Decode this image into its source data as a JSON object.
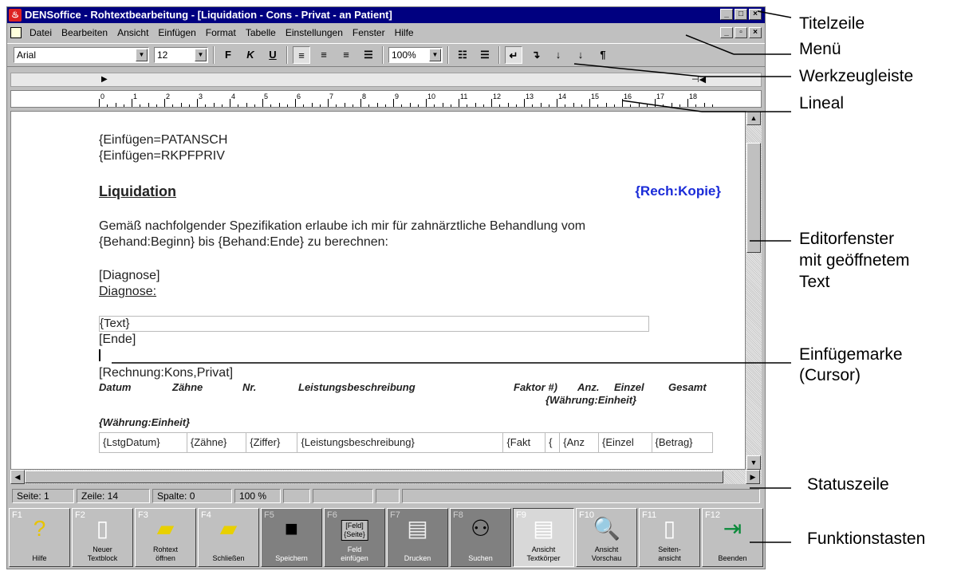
{
  "title": "DENSoffice - Rohtextbearbeitung - [Liquidation - Cons - Privat - an Patient]",
  "menu": [
    "Datei",
    "Bearbeiten",
    "Ansicht",
    "Einfügen",
    "Format",
    "Tabelle",
    "Einstellungen",
    "Fenster",
    "Hilfe"
  ],
  "toolbar": {
    "font": "Arial",
    "size": "12",
    "zoom": "100%",
    "bold": "F",
    "italic": "K",
    "underline": "U",
    "para": "¶"
  },
  "ruler": [
    "0",
    "1",
    "2",
    "3",
    "4",
    "5",
    "6",
    "7",
    "8",
    "9",
    "10",
    "11",
    "12",
    "13",
    "14",
    "15",
    "16",
    "17",
    "18"
  ],
  "doc": {
    "line1": "{Einfügen=PATANSCH",
    "line2": "{Einfügen=RKPFPRIV",
    "heading": "Liquidation",
    "copy": "{Rech:Kopie}",
    "para1": "Gemäß nachfolgender Spezifikation erlaube ich mir für zahnärztliche Behandlung vom",
    "para2": "{Behand:Beginn} bis {Behand:Ende} zu berechnen:",
    "diag1": "[Diagnose]",
    "diag2": "Diagnose:",
    "text": "{Text}",
    "end": "[Ende]",
    "rechnung": "[Rechnung:Kons,Privat]",
    "headers": [
      "Datum",
      "Zähne",
      "Nr.",
      "Leistungsbeschreibung",
      "Faktor #)",
      "Anz.",
      "Einzel",
      "Gesamt"
    ],
    "waehrung": "{Währung:Einheit}",
    "waehrung2": "{Währung:Einheit}",
    "cells": [
      "{LstgDatum}",
      "{Zähne}",
      "{Ziffer}",
      "{Leistungsbeschreibung}",
      "{Fakt",
      "{",
      "{Anz",
      "{Einzel",
      "{Betrag}"
    ]
  },
  "status": [
    "Seite:   1",
    "Zeile:  14",
    "Spalte:   0",
    "100 %",
    "",
    "",
    "",
    ""
  ],
  "fkeys": [
    {
      "fn": "F1",
      "label": "Hilfe",
      "icon": "question-icon"
    },
    {
      "fn": "F2",
      "label": "Neuer\nTextblock",
      "icon": "new-document-icon"
    },
    {
      "fn": "F3",
      "label": "Rohtext\nöffnen",
      "icon": "open-folder-icon"
    },
    {
      "fn": "F4",
      "label": "Schließen",
      "icon": "close-folder-icon"
    },
    {
      "fn": "F5",
      "label": "Speichern",
      "icon": "save-disk-icon"
    },
    {
      "fn": "F6",
      "label": "Feld\neinfügen",
      "icon": "insert-field-icon",
      "iconText": "[Feld]\n{Seite}"
    },
    {
      "fn": "F7",
      "label": "Drucken",
      "icon": "printer-icon"
    },
    {
      "fn": "F8",
      "label": "Suchen",
      "icon": "binoculars-icon"
    },
    {
      "fn": "F9",
      "label": "Ansicht\nTextkörper",
      "icon": "text-view-icon"
    },
    {
      "fn": "F10",
      "label": "Ansicht\nVorschau",
      "icon": "preview-icon"
    },
    {
      "fn": "F11",
      "label": "Seiten-\nansicht",
      "icon": "page-view-icon"
    },
    {
      "fn": "F12",
      "label": "Beenden",
      "icon": "exit-door-icon"
    }
  ],
  "callouts": {
    "titel": "Titelzeile",
    "menu": "Menü",
    "werkzeug": "Werkzeugleiste",
    "lineal": "Lineal",
    "editor": "Editorfenster\nmit geöffnetem\nText",
    "cursor": "Einfügemarke\n(Cursor)",
    "status": "Statuszeile",
    "fkeys": "Funktionstasten"
  }
}
